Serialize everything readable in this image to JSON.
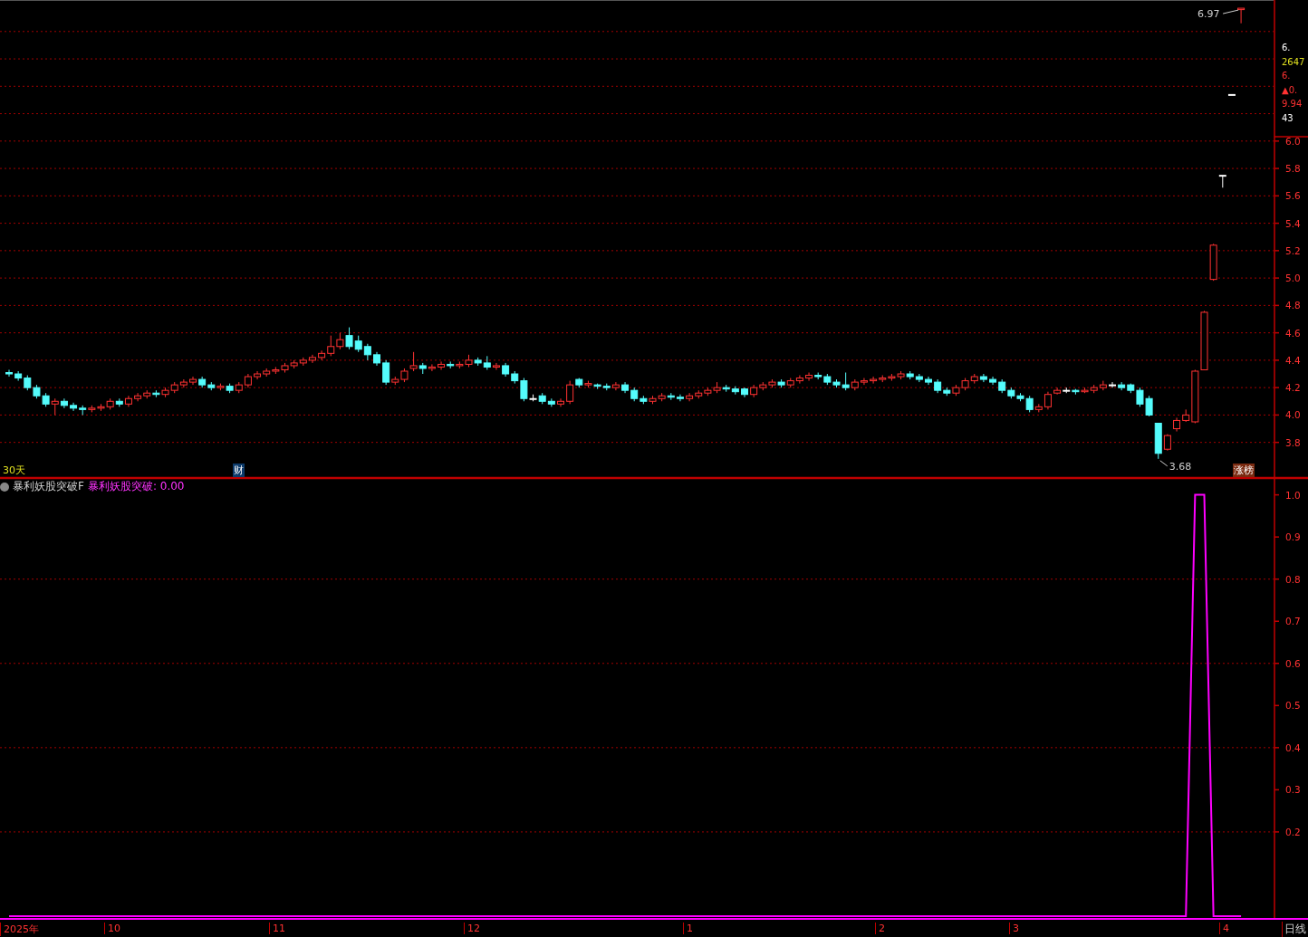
{
  "price_panel": {
    "period_label": "30天",
    "finance_badge": "财",
    "rank_badge": "涨榜",
    "quote": [
      {
        "kind": "plain",
        "text": "6."
      },
      {
        "kind": "volume",
        "text": "2647"
      },
      {
        "kind": "up",
        "text": "6."
      },
      {
        "kind": "up",
        "text": "▲0."
      },
      {
        "kind": "up",
        "text": "9.94"
      },
      {
        "kind": "plain",
        "text": "43"
      }
    ],
    "chart_data": {
      "type": "candlestick",
      "grid": true,
      "ylim": [
        3.54,
        7.03
      ],
      "yticks": [
        {
          "value": 6.0,
          "label": "6.0"
        },
        {
          "value": 5.8,
          "label": "5.8"
        },
        {
          "value": 5.6,
          "label": "5.6"
        },
        {
          "value": 5.4,
          "label": "5.4"
        },
        {
          "value": 5.2,
          "label": "5.2"
        },
        {
          "value": 5.0,
          "label": "5.0"
        },
        {
          "value": 4.8,
          "label": "4.8"
        },
        {
          "value": 4.6,
          "label": "4.6"
        },
        {
          "value": 4.4,
          "label": "4.4"
        },
        {
          "value": 4.2,
          "label": "4.2"
        },
        {
          "value": 4.0,
          "label": "4.0"
        },
        {
          "value": 3.8,
          "label": "3.8"
        }
      ],
      "ohlc": [
        [
          4.31,
          4.33,
          4.28,
          4.3
        ],
        [
          4.3,
          4.32,
          4.25,
          4.27
        ],
        [
          4.27,
          4.29,
          4.18,
          4.2
        ],
        [
          4.2,
          4.22,
          4.12,
          4.14
        ],
        [
          4.14,
          4.16,
          4.06,
          4.08
        ],
        [
          4.08,
          4.12,
          4.0,
          4.1
        ],
        [
          4.1,
          4.12,
          4.05,
          4.07
        ],
        [
          4.07,
          4.09,
          4.03,
          4.05
        ],
        [
          4.05,
          4.07,
          4.0,
          4.04
        ],
        [
          4.04,
          4.07,
          4.02,
          4.05
        ],
        [
          4.05,
          4.08,
          4.03,
          4.06
        ],
        [
          4.06,
          4.12,
          4.04,
          4.1
        ],
        [
          4.1,
          4.12,
          4.06,
          4.08
        ],
        [
          4.08,
          4.14,
          4.06,
          4.12
        ],
        [
          4.12,
          4.16,
          4.1,
          4.14
        ],
        [
          4.14,
          4.18,
          4.12,
          4.16
        ],
        [
          4.16,
          4.18,
          4.13,
          4.15
        ],
        [
          4.15,
          4.2,
          4.13,
          4.18
        ],
        [
          4.18,
          4.24,
          4.16,
          4.22
        ],
        [
          4.22,
          4.26,
          4.2,
          4.24
        ],
        [
          4.24,
          4.28,
          4.22,
          4.26
        ],
        [
          4.26,
          4.28,
          4.2,
          4.22
        ],
        [
          4.22,
          4.24,
          4.18,
          4.2
        ],
        [
          4.2,
          4.23,
          4.18,
          4.21
        ],
        [
          4.21,
          4.23,
          4.16,
          4.18
        ],
        [
          4.18,
          4.24,
          4.16,
          4.22
        ],
        [
          4.22,
          4.3,
          4.2,
          4.28
        ],
        [
          4.28,
          4.32,
          4.26,
          4.3
        ],
        [
          4.3,
          4.34,
          4.28,
          4.32
        ],
        [
          4.32,
          4.35,
          4.3,
          4.33
        ],
        [
          4.33,
          4.38,
          4.31,
          4.36
        ],
        [
          4.36,
          4.4,
          4.34,
          4.38
        ],
        [
          4.38,
          4.42,
          4.36,
          4.4
        ],
        [
          4.4,
          4.44,
          4.38,
          4.42
        ],
        [
          4.42,
          4.47,
          4.4,
          4.45
        ],
        [
          4.45,
          4.58,
          4.43,
          4.5
        ],
        [
          4.5,
          4.6,
          4.48,
          4.55
        ],
        [
          4.58,
          4.64,
          4.48,
          4.5
        ],
        [
          4.54,
          4.58,
          4.46,
          4.48
        ],
        [
          4.5,
          4.52,
          4.4,
          4.44
        ],
        [
          4.44,
          4.46,
          4.36,
          4.38
        ],
        [
          4.38,
          4.4,
          4.22,
          4.24
        ],
        [
          4.24,
          4.28,
          4.22,
          4.26
        ],
        [
          4.26,
          4.34,
          4.24,
          4.32
        ],
        [
          4.34,
          4.46,
          4.32,
          4.36
        ],
        [
          4.36,
          4.38,
          4.3,
          4.34
        ],
        [
          4.34,
          4.37,
          4.32,
          4.35
        ],
        [
          4.35,
          4.39,
          4.33,
          4.37
        ],
        [
          4.37,
          4.39,
          4.34,
          4.36
        ],
        [
          4.36,
          4.39,
          4.34,
          4.37
        ],
        [
          4.37,
          4.44,
          4.35,
          4.4
        ],
        [
          4.4,
          4.42,
          4.36,
          4.38
        ],
        [
          4.38,
          4.43,
          4.33,
          4.35
        ],
        [
          4.35,
          4.38,
          4.33,
          4.36
        ],
        [
          4.36,
          4.38,
          4.28,
          4.3
        ],
        [
          4.3,
          4.32,
          4.23,
          4.25
        ],
        [
          4.25,
          4.27,
          4.1,
          4.12
        ],
        [
          4.12,
          4.15,
          4.1,
          4.12
        ],
        [
          4.14,
          4.16,
          4.08,
          4.1
        ],
        [
          4.1,
          4.12,
          4.06,
          4.08
        ],
        [
          4.08,
          4.12,
          4.06,
          4.1
        ],
        [
          4.1,
          4.25,
          4.08,
          4.22
        ],
        [
          4.26,
          4.27,
          4.2,
          4.22
        ],
        [
          4.22,
          4.25,
          4.2,
          4.23
        ],
        [
          4.22,
          4.23,
          4.19,
          4.21
        ],
        [
          4.21,
          4.23,
          4.18,
          4.2
        ],
        [
          4.2,
          4.24,
          4.18,
          4.22
        ],
        [
          4.22,
          4.24,
          4.16,
          4.18
        ],
        [
          4.18,
          4.2,
          4.1,
          4.12
        ],
        [
          4.12,
          4.14,
          4.08,
          4.1
        ],
        [
          4.1,
          4.14,
          4.08,
          4.12
        ],
        [
          4.12,
          4.16,
          4.1,
          4.14
        ],
        [
          4.14,
          4.16,
          4.11,
          4.13
        ],
        [
          4.13,
          4.15,
          4.1,
          4.12
        ],
        [
          4.12,
          4.16,
          4.1,
          4.14
        ],
        [
          4.14,
          4.18,
          4.12,
          4.16
        ],
        [
          4.16,
          4.2,
          4.14,
          4.18
        ],
        [
          4.18,
          4.24,
          4.16,
          4.2
        ],
        [
          4.2,
          4.22,
          4.17,
          4.19
        ],
        [
          4.19,
          4.21,
          4.15,
          4.17
        ],
        [
          4.19,
          4.2,
          4.13,
          4.15
        ],
        [
          4.15,
          4.22,
          4.13,
          4.2
        ],
        [
          4.2,
          4.24,
          4.18,
          4.22
        ],
        [
          4.22,
          4.26,
          4.2,
          4.24
        ],
        [
          4.24,
          4.26,
          4.2,
          4.22
        ],
        [
          4.22,
          4.27,
          4.2,
          4.25
        ],
        [
          4.25,
          4.29,
          4.23,
          4.27
        ],
        [
          4.27,
          4.31,
          4.25,
          4.29
        ],
        [
          4.29,
          4.31,
          4.26,
          4.28
        ],
        [
          4.28,
          4.3,
          4.22,
          4.24
        ],
        [
          4.24,
          4.26,
          4.2,
          4.22
        ],
        [
          4.22,
          4.31,
          4.18,
          4.2
        ],
        [
          4.2,
          4.26,
          4.18,
          4.24
        ],
        [
          4.24,
          4.27,
          4.22,
          4.25
        ],
        [
          4.25,
          4.28,
          4.23,
          4.26
        ],
        [
          4.26,
          4.29,
          4.24,
          4.27
        ],
        [
          4.27,
          4.3,
          4.25,
          4.28
        ],
        [
          4.28,
          4.32,
          4.26,
          4.3
        ],
        [
          4.3,
          4.32,
          4.26,
          4.28
        ],
        [
          4.28,
          4.3,
          4.24,
          4.26
        ],
        [
          4.26,
          4.28,
          4.22,
          4.24
        ],
        [
          4.24,
          4.26,
          4.16,
          4.18
        ],
        [
          4.18,
          4.2,
          4.14,
          4.16
        ],
        [
          4.16,
          4.22,
          4.14,
          4.2
        ],
        [
          4.2,
          4.27,
          4.18,
          4.25
        ],
        [
          4.25,
          4.3,
          4.23,
          4.28
        ],
        [
          4.28,
          4.3,
          4.24,
          4.26
        ],
        [
          4.26,
          4.28,
          4.22,
          4.24
        ],
        [
          4.24,
          4.26,
          4.16,
          4.18
        ],
        [
          4.18,
          4.2,
          4.12,
          4.14
        ],
        [
          4.14,
          4.16,
          4.1,
          4.12
        ],
        [
          4.12,
          4.14,
          4.02,
          4.04
        ],
        [
          4.04,
          4.08,
          4.02,
          4.06
        ],
        [
          4.06,
          4.17,
          4.04,
          4.15
        ],
        [
          4.16,
          4.2,
          4.15,
          4.18
        ],
        [
          4.18,
          4.2,
          4.16,
          4.18
        ],
        [
          4.18,
          4.19,
          4.15,
          4.17
        ],
        [
          4.17,
          4.2,
          4.16,
          4.18
        ],
        [
          4.18,
          4.22,
          4.16,
          4.2
        ],
        [
          4.2,
          4.25,
          4.18,
          4.22
        ],
        [
          4.22,
          4.24,
          4.2,
          4.22
        ],
        [
          4.22,
          4.24,
          4.18,
          4.2
        ],
        [
          4.22,
          4.23,
          4.16,
          4.18
        ],
        [
          4.18,
          4.2,
          4.06,
          4.08
        ],
        [
          4.12,
          4.14,
          3.99,
          4.0
        ],
        [
          3.94,
          3.94,
          3.68,
          3.72
        ],
        [
          3.75,
          3.86,
          3.74,
          3.85
        ],
        [
          3.9,
          3.98,
          3.88,
          3.96
        ],
        [
          3.96,
          4.04,
          3.95,
          4.0
        ],
        [
          3.95,
          4.33,
          3.94,
          4.32
        ],
        [
          4.33,
          4.76,
          4.33,
          4.75
        ],
        [
          4.99,
          5.25,
          4.98,
          5.24
        ],
        [
          5.75,
          5.75,
          5.66,
          5.75
        ],
        [
          6.34,
          6.34,
          6.34,
          6.34
        ],
        [
          6.96,
          6.97,
          6.86,
          6.97
        ]
      ],
      "annotations": [
        "6.97",
        "3.68"
      ]
    }
  },
  "indicator_panel": {
    "name": "暴利妖股突破F",
    "reading": ": 0.00",
    "period": "日线",
    "date_axis": [
      {
        "label": "2025年"
      },
      {
        "label": "10"
      },
      {
        "label": "11"
      },
      {
        "label": "12"
      },
      {
        "label": "1"
      },
      {
        "label": "2"
      },
      {
        "label": "3"
      },
      {
        "label": "4"
      }
    ],
    "chart_data": {
      "type": "line",
      "grid": true,
      "ylim": [
        0,
        1.04
      ],
      "yticks": [
        {
          "value": 1.0,
          "label": "1.0"
        },
        {
          "value": 0.9,
          "label": "0.9"
        },
        {
          "value": 0.8,
          "label": "0.8"
        },
        {
          "value": 0.7,
          "label": "0.7"
        },
        {
          "value": 0.6,
          "label": "0.6"
        },
        {
          "value": 0.5,
          "label": "0.5"
        },
        {
          "value": 0.4,
          "label": "0.4"
        },
        {
          "value": 0.3,
          "label": "0.3"
        },
        {
          "value": 0.2,
          "label": "0.2"
        }
      ],
      "series": [
        {
          "name": "暴利妖股突破",
          "color": "#ff00ff",
          "values": [
            0,
            0,
            0,
            0,
            0,
            0,
            0,
            0,
            0,
            0,
            0,
            0,
            0,
            0,
            0,
            0,
            0,
            0,
            0,
            0,
            0,
            0,
            0,
            0,
            0,
            0,
            0,
            0,
            0,
            0,
            0,
            0,
            0,
            0,
            0,
            0,
            0,
            0,
            0,
            0,
            0,
            0,
            0,
            0,
            0,
            0,
            0,
            0,
            0,
            0,
            0,
            0,
            0,
            0,
            0,
            0,
            0,
            0,
            0,
            0,
            0,
            0,
            0,
            0,
            0,
            0,
            0,
            0,
            0,
            0,
            0,
            0,
            0,
            0,
            0,
            0,
            0,
            0,
            0,
            0,
            0,
            0,
            0,
            0,
            0,
            0,
            0,
            0,
            0,
            0,
            0,
            0,
            0,
            0,
            0,
            0,
            0,
            0,
            0,
            0,
            0,
            0,
            0,
            0,
            0,
            0,
            0,
            0,
            0,
            0,
            0,
            0,
            0,
            0,
            0,
            0,
            0,
            0,
            0,
            0,
            0,
            0,
            0,
            0,
            0,
            0,
            0,
            0,
            0,
            1,
            1,
            0,
            0,
            0,
            0
          ]
        }
      ]
    }
  }
}
